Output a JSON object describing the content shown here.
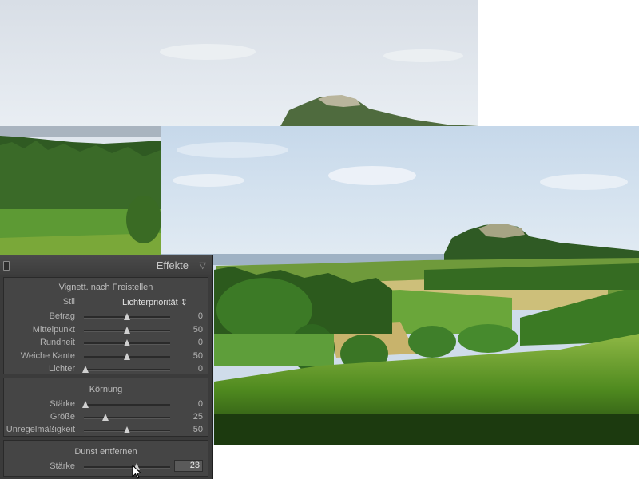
{
  "panel": {
    "title": "Effekte",
    "collapse_glyph": "▽",
    "vignette": {
      "title": "Vignett. nach Freistellen",
      "style_label": "Stil",
      "style_value": "Lichterpriorität ⇕",
      "sliders": [
        {
          "label": "Betrag",
          "value": "0",
          "position": 0.5
        },
        {
          "label": "Mittelpunkt",
          "value": "50",
          "position": 0.5
        },
        {
          "label": "Rundheit",
          "value": "0",
          "position": 0.5
        },
        {
          "label": "Weiche Kante",
          "value": "50",
          "position": 0.5
        },
        {
          "label": "Lichter",
          "value": "0",
          "position": 0.0
        }
      ]
    },
    "grain": {
      "title": "Körnung",
      "sliders": [
        {
          "label": "Stärke",
          "value": "0",
          "position": 0.0
        },
        {
          "label": "Größe",
          "value": "25",
          "position": 0.25
        },
        {
          "label": "Unregelmäßigkeit",
          "value": "50",
          "position": 0.5
        }
      ]
    },
    "haze": {
      "title": "Dunst entfernen",
      "slider": {
        "label": "Stärke",
        "value": "+ 23",
        "position": 0.615
      }
    }
  },
  "colors": {
    "panel_bg": "#3b3b3b",
    "section_bg": "#454545",
    "text": "#b3b3b3"
  }
}
